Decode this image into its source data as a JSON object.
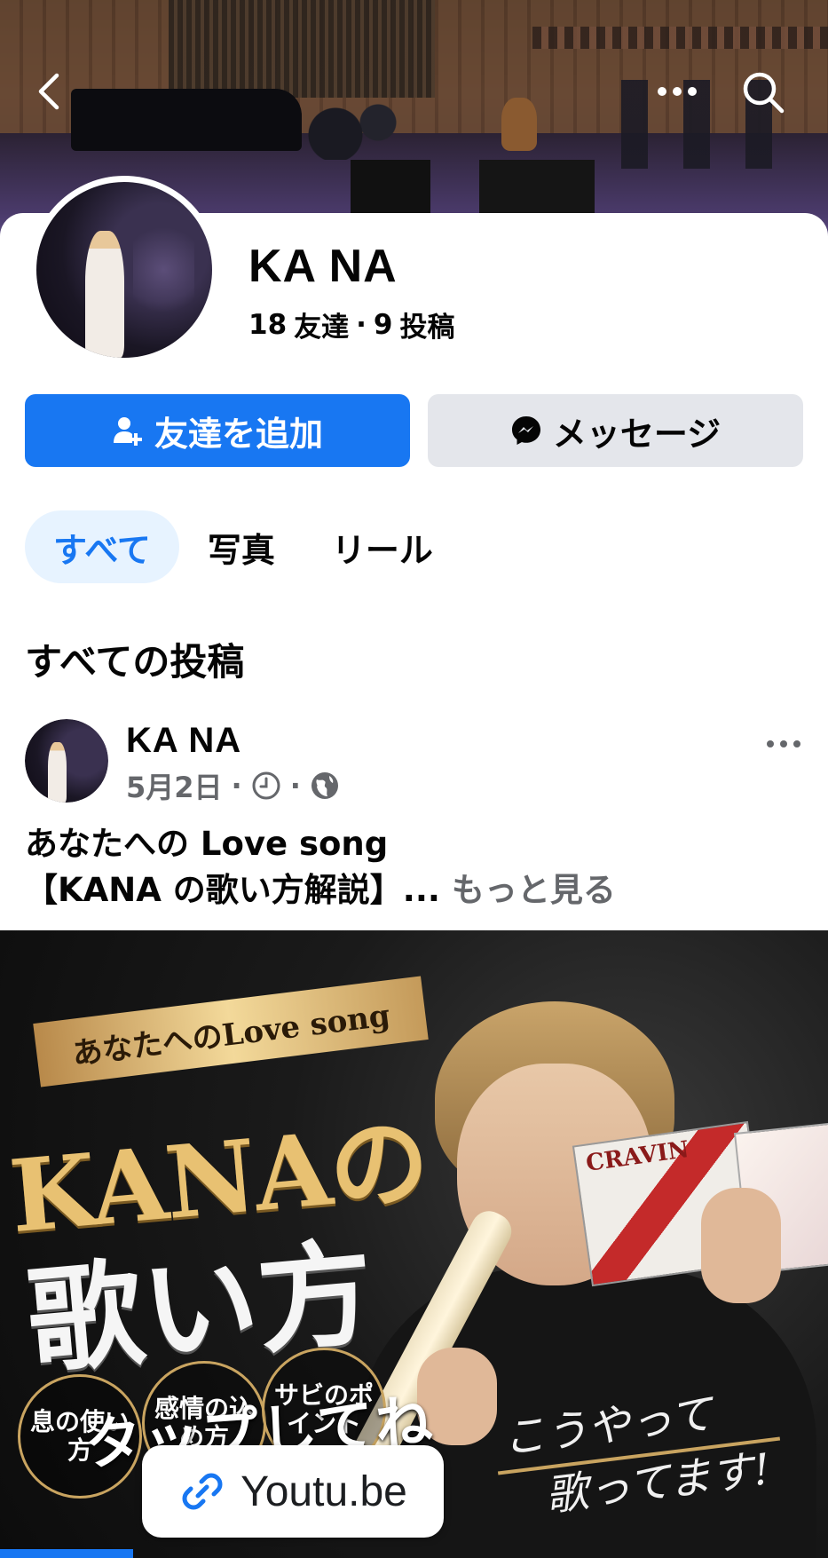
{
  "profile": {
    "name": "KA NA",
    "friends_count": "18",
    "friends_label": "友達",
    "separator": "·",
    "posts_count": "9",
    "posts_label": "投稿"
  },
  "actions": {
    "add_friend_label": "友達を追加",
    "message_label": "メッセージ"
  },
  "tabs": [
    {
      "label": "すべて",
      "active": true
    },
    {
      "label": "写真",
      "active": false
    },
    {
      "label": "リール",
      "active": false
    }
  ],
  "section": {
    "title": "すべての投稿"
  },
  "post": {
    "author": "KA NA",
    "date": "5月2日",
    "dot": "·",
    "text_line1": "あなたへの Love song",
    "text_line2": "【KANA の歌い方解説】...",
    "see_more": "もっと見る"
  },
  "thumbnail": {
    "banner": "あなたへのLove song",
    "title": "KANAの",
    "subtitle": "歌い方",
    "circle1": "息の使い方",
    "circle2": "感情の込め方",
    "circle3": "サビのポイント",
    "tap_text": "タップしてね",
    "handwritten_line1": "こうやって",
    "handwritten_line2": "歌ってます!",
    "cd_text": "CRAVIN",
    "link_label": "Youtu.be"
  },
  "colors": {
    "accent": "#1877f2",
    "secondary_button": "#e4e6eb",
    "active_tab_bg": "#e7f3ff",
    "muted_text": "#65676b"
  },
  "icons": {
    "back": "chevron-left-icon",
    "more": "more-horizontal-icon",
    "search": "search-icon",
    "add_friend": "person-add-icon",
    "messenger": "messenger-icon",
    "clock": "clock-icon",
    "globe": "globe-icon",
    "link": "link-icon"
  }
}
